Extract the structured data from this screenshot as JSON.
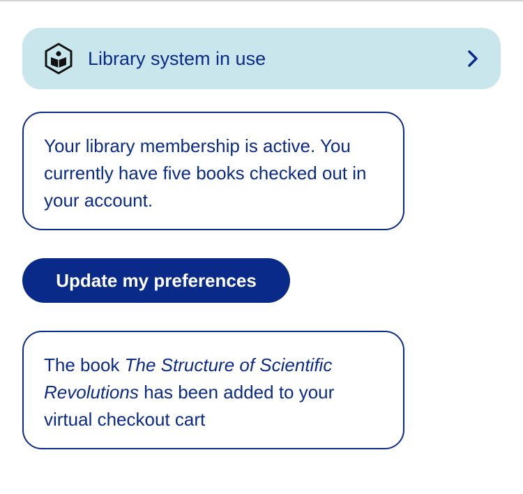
{
  "status_bar": {
    "label": "Library system in use",
    "icon": "library-book-hexagon-icon",
    "chevron_icon": "chevron-right-icon",
    "background_color": "#c9e6ec",
    "text_color": "#0a2a8a"
  },
  "messages": [
    {
      "text": "Your library membership is active. You currently have five books checked out in your account."
    },
    {
      "prefix": "The book ",
      "title_italic": "The Structure of Scientific Revolutions",
      "suffix": " has been added to your virtual checkout cart"
    }
  ],
  "actions": {
    "update_preferences_label": "Update my preferences",
    "button_color": "#0a2a8a"
  }
}
